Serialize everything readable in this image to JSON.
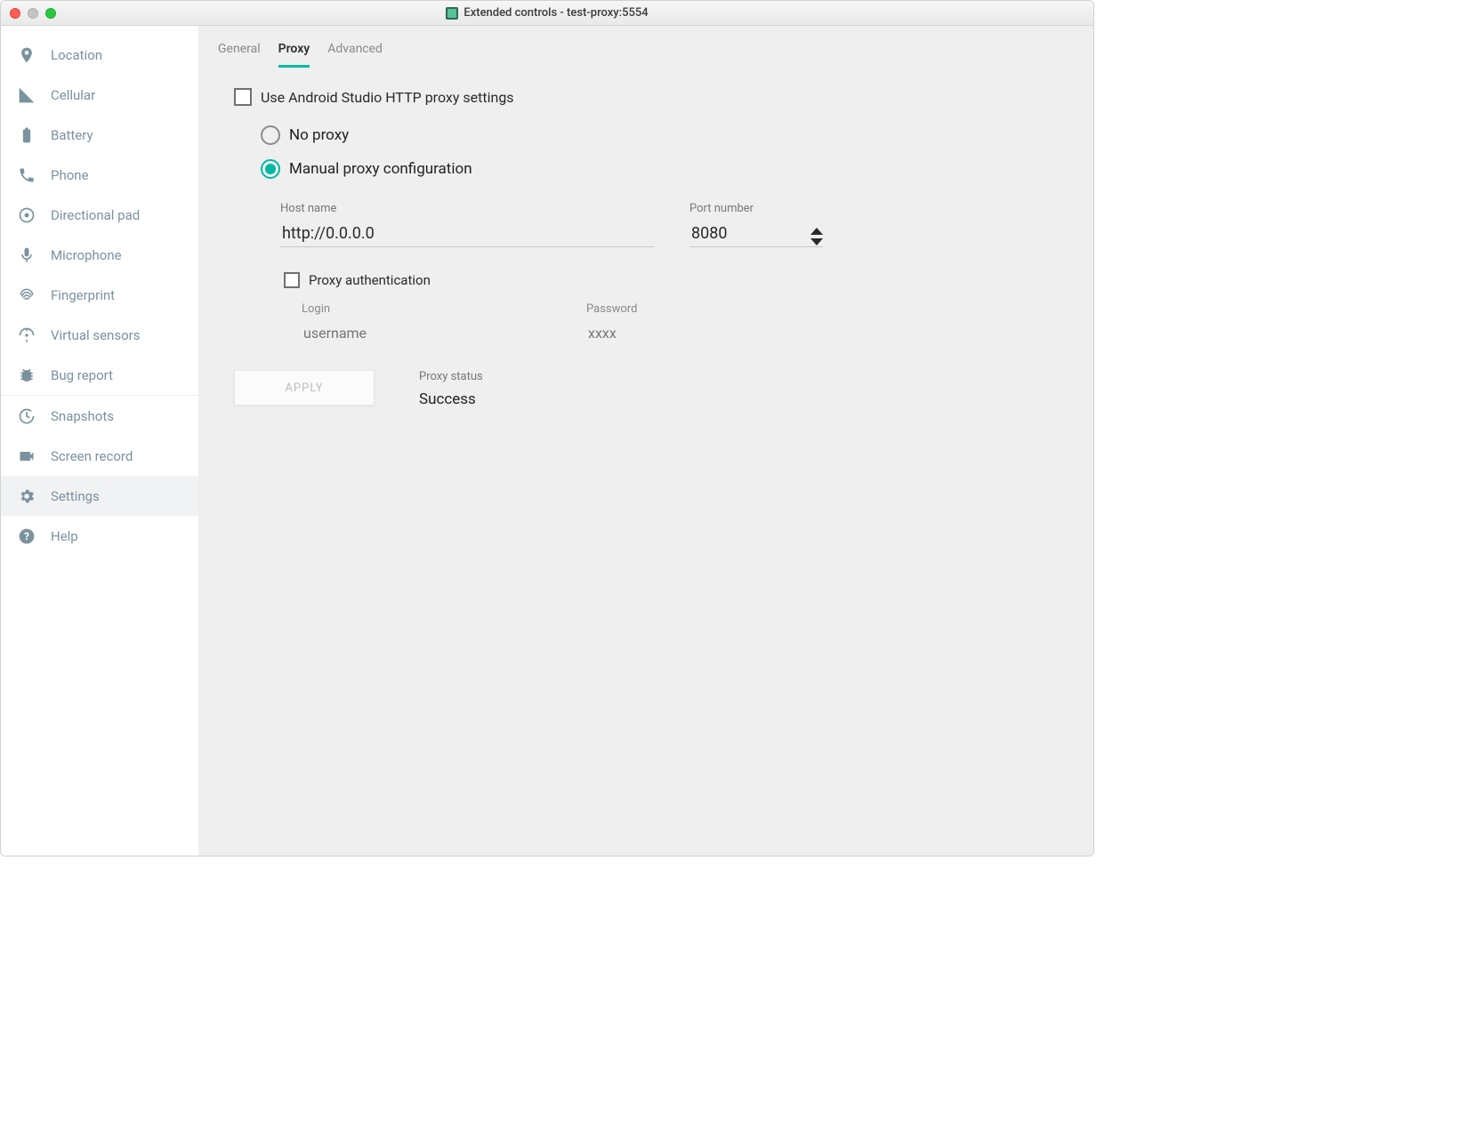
{
  "window": {
    "title": "Extended controls - test-proxy:5554"
  },
  "sidebar": {
    "items": [
      {
        "label": "Location"
      },
      {
        "label": "Cellular"
      },
      {
        "label": "Battery"
      },
      {
        "label": "Phone"
      },
      {
        "label": "Directional pad"
      },
      {
        "label": "Microphone"
      },
      {
        "label": "Fingerprint"
      },
      {
        "label": "Virtual sensors"
      },
      {
        "label": "Bug report"
      },
      {
        "label": "Snapshots"
      },
      {
        "label": "Screen record"
      },
      {
        "label": "Settings"
      },
      {
        "label": "Help"
      }
    ],
    "selected_index": 11
  },
  "tabs": {
    "items": [
      "General",
      "Proxy",
      "Advanced"
    ],
    "active_index": 1
  },
  "proxy": {
    "use_android_studio_label": "Use Android Studio HTTP proxy settings",
    "use_android_studio_checked": false,
    "no_proxy_label": "No proxy",
    "manual_label": "Manual proxy configuration",
    "selected_mode": "manual",
    "host_label": "Host name",
    "host_value": "http://0.0.0.0",
    "port_label": "Port number",
    "port_value": "8080",
    "auth_label": "Proxy authentication",
    "auth_checked": false,
    "login_label": "Login",
    "login_placeholder": "username",
    "password_label": "Password",
    "password_placeholder": "xxxx",
    "apply_label": "APPLY",
    "status_label": "Proxy status",
    "status_value": "Success"
  }
}
